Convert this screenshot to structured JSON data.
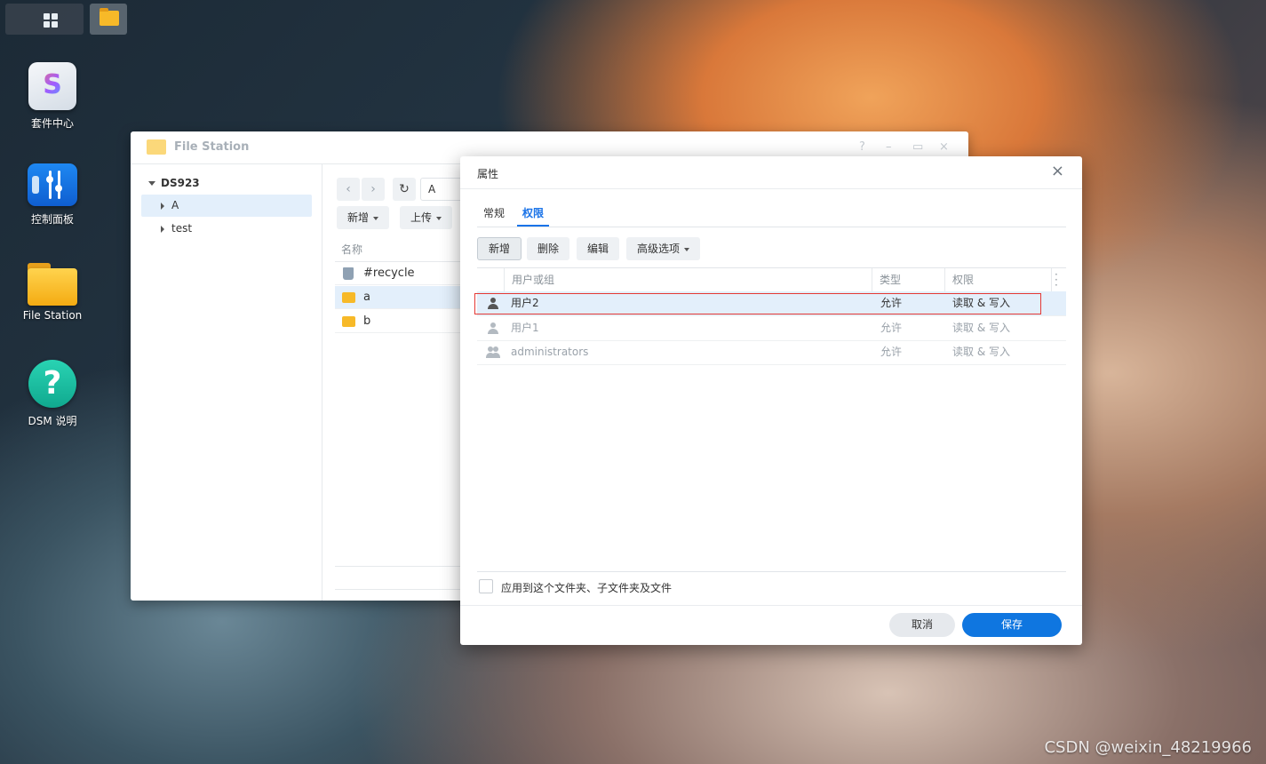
{
  "desktop": {
    "icons": [
      {
        "label": "套件中心"
      },
      {
        "label": "控制面板"
      },
      {
        "label": "File Station"
      },
      {
        "label": "DSM 说明"
      }
    ]
  },
  "file_station": {
    "title": "File Station",
    "window_controls": {
      "help": "?",
      "minimize": "–",
      "maximize": "▭",
      "close": "×"
    },
    "tree": {
      "root": "DS923",
      "items": [
        "A",
        "test"
      ]
    },
    "path": "A",
    "toolbar": {
      "create": "新增",
      "upload": "上传"
    },
    "column_name": "名称",
    "files": [
      "#recycle",
      "a",
      "b"
    ]
  },
  "dialog": {
    "title": "属性",
    "close": "×",
    "tabs": [
      "常规",
      "权限"
    ],
    "buttons": {
      "create": "新增",
      "delete": "删除",
      "edit": "编辑",
      "advanced": "高级选项"
    },
    "columns": {
      "user": "用户或组",
      "type": "类型",
      "permission": "权限"
    },
    "rows": [
      {
        "name": "用户2",
        "type": "允许",
        "permission": "读取 & 写入"
      },
      {
        "name": "用户1",
        "type": "允许",
        "permission": "读取 & 写入"
      },
      {
        "name": "administrators",
        "type": "允许",
        "permission": "读取 & 写入"
      }
    ],
    "apply_label": "应用到这个文件夹、子文件夹及文件",
    "cancel": "取消",
    "save": "保存"
  },
  "watermark": "CSDN @weixin_48219966",
  "colors": {
    "accent": "#1a73e8",
    "save_button": "#0f76e0",
    "highlight_box": "#e53935",
    "selected_row": "#e3effb"
  }
}
